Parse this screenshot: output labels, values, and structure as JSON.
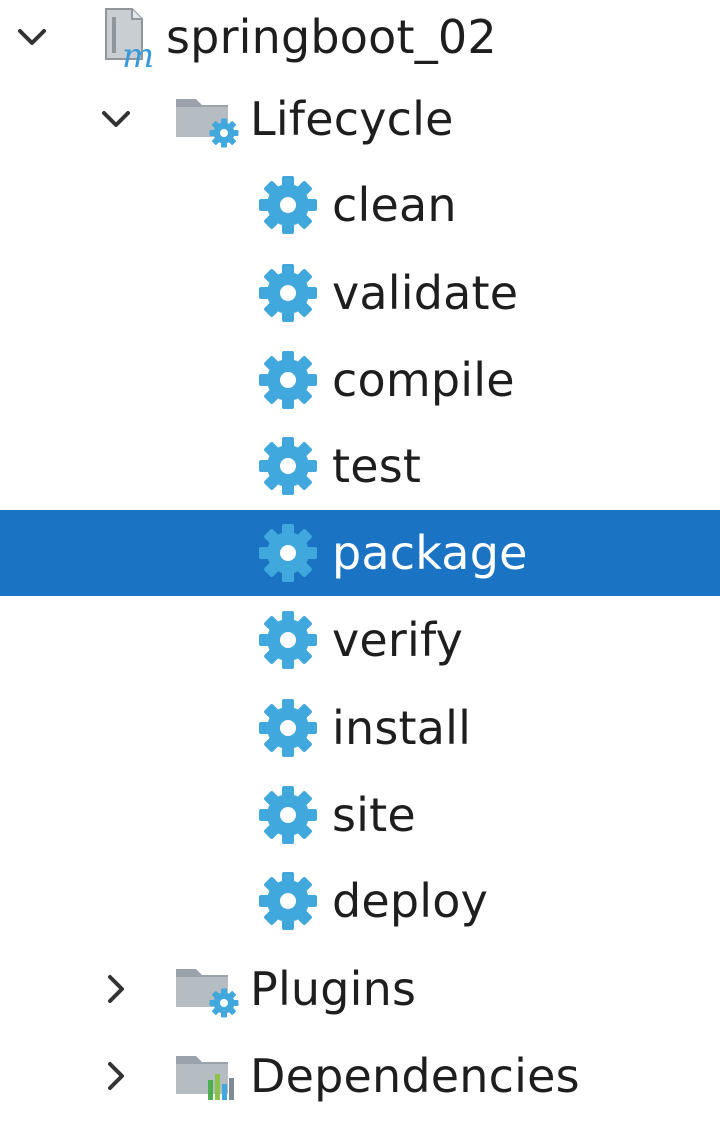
{
  "tree": {
    "project": {
      "label": "springboot_02",
      "expanded": true,
      "icon": "maven-project-icon"
    },
    "lifecycle": {
      "label": "Lifecycle",
      "expanded": true,
      "icon": "folder-gear-icon",
      "goals": [
        {
          "label": "clean",
          "icon": "gear-icon"
        },
        {
          "label": "validate",
          "icon": "gear-icon"
        },
        {
          "label": "compile",
          "icon": "gear-icon"
        },
        {
          "label": "test",
          "icon": "gear-icon"
        },
        {
          "label": "package",
          "icon": "gear-icon",
          "selected": true
        },
        {
          "label": "verify",
          "icon": "gear-icon"
        },
        {
          "label": "install",
          "icon": "gear-icon"
        },
        {
          "label": "site",
          "icon": "gear-icon"
        },
        {
          "label": "deploy",
          "icon": "gear-icon"
        }
      ]
    },
    "plugins": {
      "label": "Plugins",
      "expanded": false,
      "icon": "folder-gear-icon"
    },
    "dependencies": {
      "label": "Dependencies",
      "expanded": false,
      "icon": "folder-chart-icon"
    }
  },
  "colors": {
    "selection": "#1b73c4",
    "gear": "#40a8dc",
    "folder": "#9aa3ab",
    "maven_m": "#3a9ad9"
  }
}
